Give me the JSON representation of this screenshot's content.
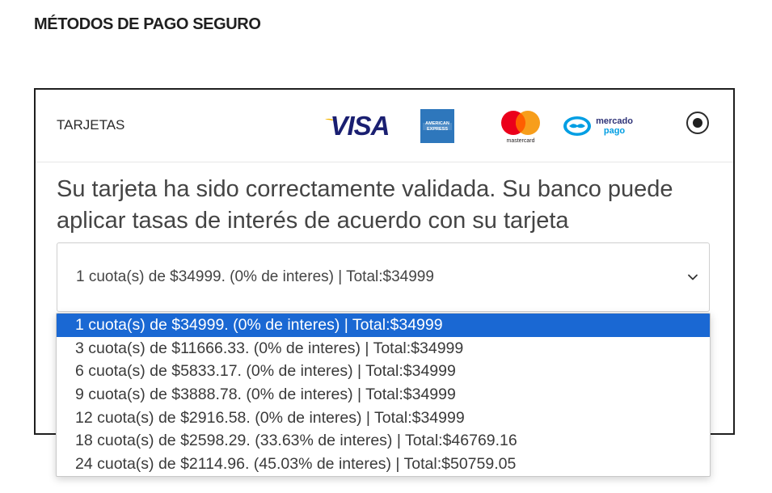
{
  "section": {
    "title": "MÉTODOS DE PAGO SEGURO"
  },
  "payment_option": {
    "label": "TARJETAS",
    "logos": [
      {
        "name": "visa-logo",
        "text": "VISA"
      },
      {
        "name": "amex-logo",
        "text": "AMERICAN EXPRESS"
      },
      {
        "name": "mastercard-logo",
        "text": "mastercard"
      },
      {
        "name": "mercadopago-logo",
        "text": "mercado pago"
      }
    ],
    "radio_selected": true,
    "message": "Su tarjeta ha sido correctamente validada. Su banco puede aplicar tasas de interés de acuerdo con su tarjeta"
  },
  "installments": {
    "selected_value": "1 cuota(s) de $34999. (0% de interes) | Total:$34999",
    "selected_index": 0,
    "options": [
      "1 cuota(s) de $34999. (0% de interes) | Total:$34999",
      "3 cuota(s) de $11666.33. (0% de interes) | Total:$34999",
      "6 cuota(s) de $5833.17. (0% de interes) | Total:$34999",
      "9 cuota(s) de $3888.78. (0% de interes) | Total:$34999",
      "12 cuota(s) de $2916.58. (0% de interes) | Total:$34999",
      "18 cuota(s) de $2598.29. (33.63% de interes) | Total:$46769.16",
      "24 cuota(s) de $2114.96. (45.03% de interes) | Total:$50759.05"
    ]
  },
  "colors": {
    "option_highlight": "#1a68d3",
    "visa_blue": "#1a1f71",
    "visa_gold": "#f7b600",
    "amex_blue": "#2e77bc",
    "mastercard_red": "#eb001b",
    "mastercard_orange": "#f79e1b",
    "mercadopago_blue": "#009ee3"
  }
}
